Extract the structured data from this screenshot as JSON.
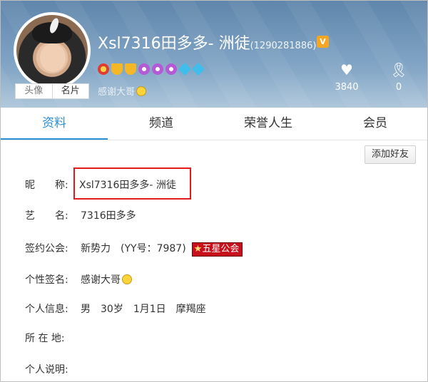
{
  "profile": {
    "display_name": "Xsl7316田多多- 洲徒",
    "uid": "(1290281886)",
    "vip_badge": "V",
    "signature": "感谢大哥",
    "avatar_tabs": [
      "头像",
      "名片"
    ],
    "medal_icons": [
      "heart-medal-icon",
      "crown-icon",
      "crown-icon",
      "purple-medal-icon",
      "purple-medal-icon",
      "purple-medal-icon",
      "diamond-icon",
      "diamond-icon"
    ]
  },
  "stats": {
    "likes": "3840",
    "rank": "0"
  },
  "tabs": [
    "资料",
    "频道",
    "荣誉人生",
    "会员"
  ],
  "add_friend_label": "添加好友",
  "info": {
    "nickname_label": "昵　　称:",
    "nickname_value": "Xsl7316田多多- 洲徒",
    "stage_label": "艺　　名:",
    "stage_value": "7316田多多",
    "guild_label": "签约公会:",
    "guild_value": "新势力　(YY号：7987)",
    "guild_badge": "五星公会",
    "sign_label": "个性签名:",
    "sign_value": "感谢大哥",
    "personal_label": "个人信息:",
    "personal_value": "男　30岁　1月1日　摩羯座",
    "location_label": "所 在 地:",
    "location_value": "",
    "desc_label": "个人说明:",
    "desc_value": ""
  },
  "colors": {
    "accent": "#2b8fd6",
    "highlight": "#e11b1b",
    "header": "#6d92b6"
  }
}
